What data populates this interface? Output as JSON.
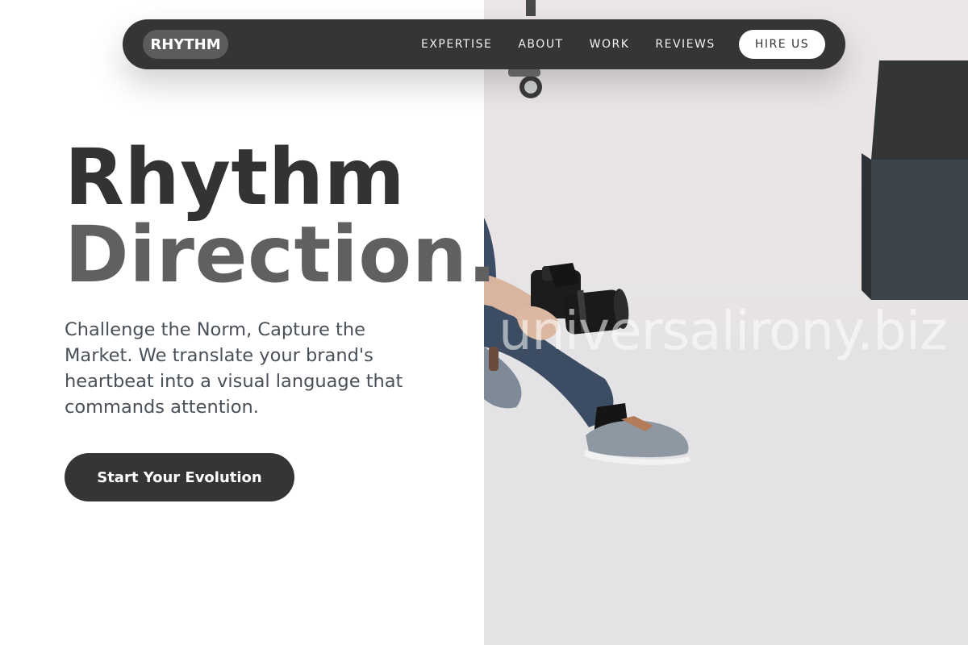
{
  "nav": {
    "logo": "RHYTHM",
    "links": [
      {
        "label": "EXPERTISE"
      },
      {
        "label": "ABOUT"
      },
      {
        "label": "WORK"
      },
      {
        "label": "REVIEWS"
      }
    ],
    "cta_label": "HIRE US"
  },
  "hero": {
    "title_line1": "Rhythm",
    "title_line2": "Direction.",
    "subtitle": "Challenge the Norm, Capture the Market. We translate your brand's heartbeat into a visual language that commands attention.",
    "cta_label": "Start Your Evolution"
  },
  "photo": {
    "watermark": "universalirony.biz"
  },
  "colors": {
    "dark": "#353535",
    "title_primary": "#333333",
    "title_secondary": "#606060",
    "body_text": "#4a5058",
    "logo_pill": "#5c5c5c",
    "white": "#ffffff"
  }
}
